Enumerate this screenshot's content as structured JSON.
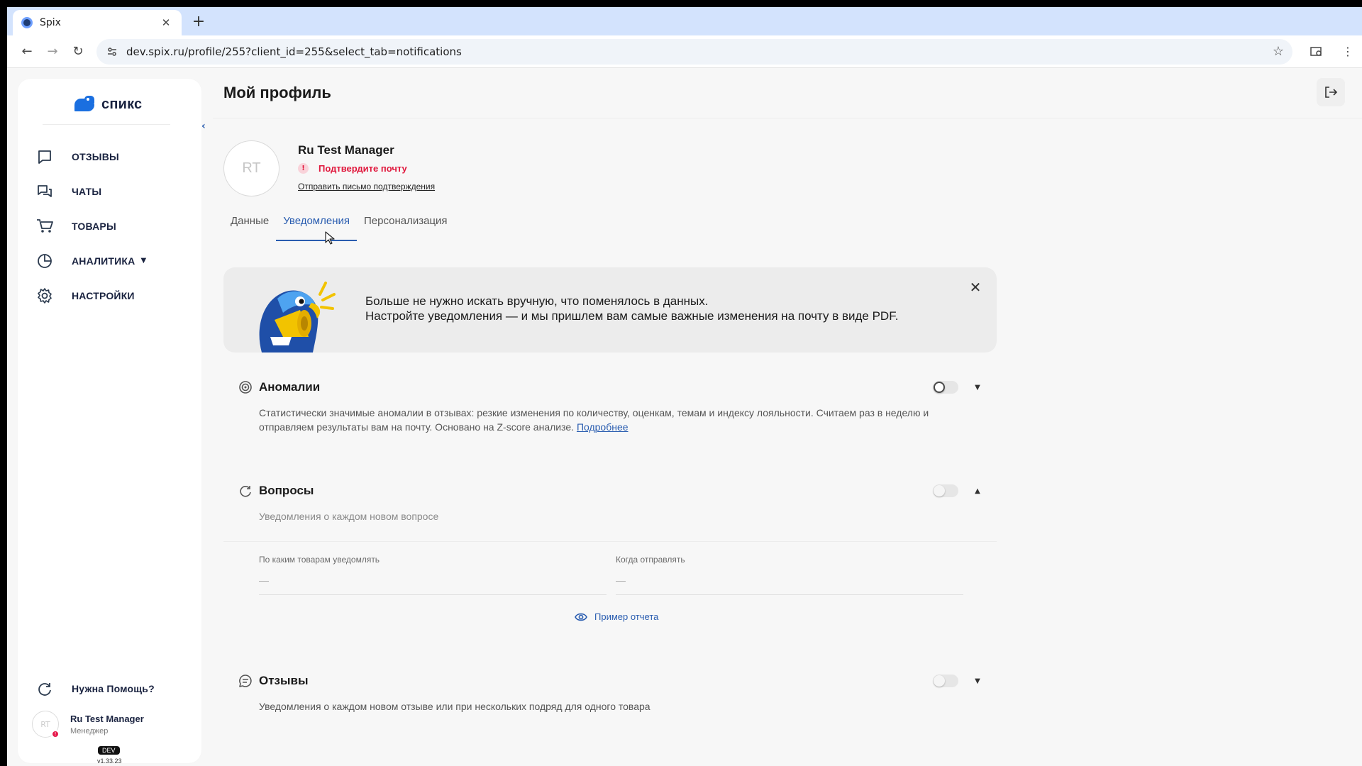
{
  "browser": {
    "tab_title": "Spix",
    "url": "dev.spix.ru/profile/255?client_id=255&select_tab=notifications"
  },
  "sidebar": {
    "logo_text": "спикс",
    "items": [
      {
        "label": "ОТЗЫВЫ",
        "icon": "reviews-icon"
      },
      {
        "label": "ЧАТЫ",
        "icon": "chats-icon"
      },
      {
        "label": "ТОВАРЫ",
        "icon": "cart-icon"
      },
      {
        "label": "АНАЛИТИКА",
        "icon": "analytics-icon"
      },
      {
        "label": "НАСТРОЙКИ",
        "icon": "gear-icon"
      }
    ],
    "help_label": "Нужна Помощь?",
    "user_initials": "RT",
    "user_name": "Ru Test Manager",
    "user_role": "Менеджер",
    "env_badge": "DEV",
    "version": "v1.33.23"
  },
  "page": {
    "title": "Мой профиль",
    "avatar_initials": "RT",
    "name": "Ru Test Manager",
    "confirm_email": "Подтвердите почту",
    "resend_link": "Отправить письмо подтверждения",
    "tabs": [
      {
        "label": "Данные"
      },
      {
        "label": "Уведомления",
        "active": true
      },
      {
        "label": "Персонализация"
      }
    ]
  },
  "banner": {
    "line1": "Больше не нужно искать вручную, что поменялось в данных.",
    "line2": "Настройте уведомления — и мы пришлем вам самые важные изменения на почту в виде PDF."
  },
  "sections": {
    "anomalies": {
      "title": "Аномалии",
      "desc": "Статистически значимые аномалии в отзывах: резкие изменения по количеству, оценкам, темам и индексу лояльности. Считаем раз в неделю и отправляем результаты вам на почту. Основано на Z-score анализе.",
      "link": "Подробнее",
      "enabled": false
    },
    "questions": {
      "title": "Вопросы",
      "desc": "Уведомления о каждом новом вопросе",
      "enabled": false,
      "products_label": "По каким товарам уведомлять",
      "products_value": "—",
      "when_label": "Когда отправлять",
      "when_value": "—",
      "example_link": "Пример отчета"
    },
    "reviews": {
      "title": "Отзывы",
      "desc": "Уведомления о каждом новом отзыве или при нескольких подряд для одного товара",
      "enabled": false
    }
  },
  "colors": {
    "accent": "#2a5db0",
    "warning": "#e0173c",
    "brand": "#1a6fe0"
  }
}
